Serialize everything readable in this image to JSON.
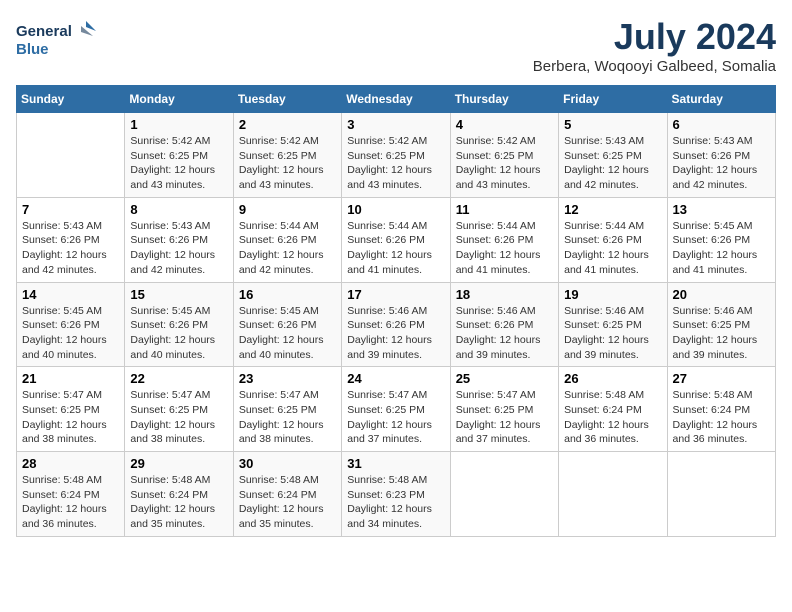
{
  "header": {
    "logo_line1": "General",
    "logo_line2": "Blue",
    "month_year": "July 2024",
    "location": "Berbera, Woqooyi Galbeed, Somalia"
  },
  "days_of_week": [
    "Sunday",
    "Monday",
    "Tuesday",
    "Wednesday",
    "Thursday",
    "Friday",
    "Saturday"
  ],
  "weeks": [
    [
      {
        "day": "",
        "detail": ""
      },
      {
        "day": "1",
        "detail": "Sunrise: 5:42 AM\nSunset: 6:25 PM\nDaylight: 12 hours\nand 43 minutes."
      },
      {
        "day": "2",
        "detail": "Sunrise: 5:42 AM\nSunset: 6:25 PM\nDaylight: 12 hours\nand 43 minutes."
      },
      {
        "day": "3",
        "detail": "Sunrise: 5:42 AM\nSunset: 6:25 PM\nDaylight: 12 hours\nand 43 minutes."
      },
      {
        "day": "4",
        "detail": "Sunrise: 5:42 AM\nSunset: 6:25 PM\nDaylight: 12 hours\nand 43 minutes."
      },
      {
        "day": "5",
        "detail": "Sunrise: 5:43 AM\nSunset: 6:25 PM\nDaylight: 12 hours\nand 42 minutes."
      },
      {
        "day": "6",
        "detail": "Sunrise: 5:43 AM\nSunset: 6:26 PM\nDaylight: 12 hours\nand 42 minutes."
      }
    ],
    [
      {
        "day": "7",
        "detail": "Sunrise: 5:43 AM\nSunset: 6:26 PM\nDaylight: 12 hours\nand 42 minutes."
      },
      {
        "day": "8",
        "detail": "Sunrise: 5:43 AM\nSunset: 6:26 PM\nDaylight: 12 hours\nand 42 minutes."
      },
      {
        "day": "9",
        "detail": "Sunrise: 5:44 AM\nSunset: 6:26 PM\nDaylight: 12 hours\nand 42 minutes."
      },
      {
        "day": "10",
        "detail": "Sunrise: 5:44 AM\nSunset: 6:26 PM\nDaylight: 12 hours\nand 41 minutes."
      },
      {
        "day": "11",
        "detail": "Sunrise: 5:44 AM\nSunset: 6:26 PM\nDaylight: 12 hours\nand 41 minutes."
      },
      {
        "day": "12",
        "detail": "Sunrise: 5:44 AM\nSunset: 6:26 PM\nDaylight: 12 hours\nand 41 minutes."
      },
      {
        "day": "13",
        "detail": "Sunrise: 5:45 AM\nSunset: 6:26 PM\nDaylight: 12 hours\nand 41 minutes."
      }
    ],
    [
      {
        "day": "14",
        "detail": "Sunrise: 5:45 AM\nSunset: 6:26 PM\nDaylight: 12 hours\nand 40 minutes."
      },
      {
        "day": "15",
        "detail": "Sunrise: 5:45 AM\nSunset: 6:26 PM\nDaylight: 12 hours\nand 40 minutes."
      },
      {
        "day": "16",
        "detail": "Sunrise: 5:45 AM\nSunset: 6:26 PM\nDaylight: 12 hours\nand 40 minutes."
      },
      {
        "day": "17",
        "detail": "Sunrise: 5:46 AM\nSunset: 6:26 PM\nDaylight: 12 hours\nand 39 minutes."
      },
      {
        "day": "18",
        "detail": "Sunrise: 5:46 AM\nSunset: 6:26 PM\nDaylight: 12 hours\nand 39 minutes."
      },
      {
        "day": "19",
        "detail": "Sunrise: 5:46 AM\nSunset: 6:25 PM\nDaylight: 12 hours\nand 39 minutes."
      },
      {
        "day": "20",
        "detail": "Sunrise: 5:46 AM\nSunset: 6:25 PM\nDaylight: 12 hours\nand 39 minutes."
      }
    ],
    [
      {
        "day": "21",
        "detail": "Sunrise: 5:47 AM\nSunset: 6:25 PM\nDaylight: 12 hours\nand 38 minutes."
      },
      {
        "day": "22",
        "detail": "Sunrise: 5:47 AM\nSunset: 6:25 PM\nDaylight: 12 hours\nand 38 minutes."
      },
      {
        "day": "23",
        "detail": "Sunrise: 5:47 AM\nSunset: 6:25 PM\nDaylight: 12 hours\nand 38 minutes."
      },
      {
        "day": "24",
        "detail": "Sunrise: 5:47 AM\nSunset: 6:25 PM\nDaylight: 12 hours\nand 37 minutes."
      },
      {
        "day": "25",
        "detail": "Sunrise: 5:47 AM\nSunset: 6:25 PM\nDaylight: 12 hours\nand 37 minutes."
      },
      {
        "day": "26",
        "detail": "Sunrise: 5:48 AM\nSunset: 6:24 PM\nDaylight: 12 hours\nand 36 minutes."
      },
      {
        "day": "27",
        "detail": "Sunrise: 5:48 AM\nSunset: 6:24 PM\nDaylight: 12 hours\nand 36 minutes."
      }
    ],
    [
      {
        "day": "28",
        "detail": "Sunrise: 5:48 AM\nSunset: 6:24 PM\nDaylight: 12 hours\nand 36 minutes."
      },
      {
        "day": "29",
        "detail": "Sunrise: 5:48 AM\nSunset: 6:24 PM\nDaylight: 12 hours\nand 35 minutes."
      },
      {
        "day": "30",
        "detail": "Sunrise: 5:48 AM\nSunset: 6:24 PM\nDaylight: 12 hours\nand 35 minutes."
      },
      {
        "day": "31",
        "detail": "Sunrise: 5:48 AM\nSunset: 6:23 PM\nDaylight: 12 hours\nand 34 minutes."
      },
      {
        "day": "",
        "detail": ""
      },
      {
        "day": "",
        "detail": ""
      },
      {
        "day": "",
        "detail": ""
      }
    ]
  ]
}
